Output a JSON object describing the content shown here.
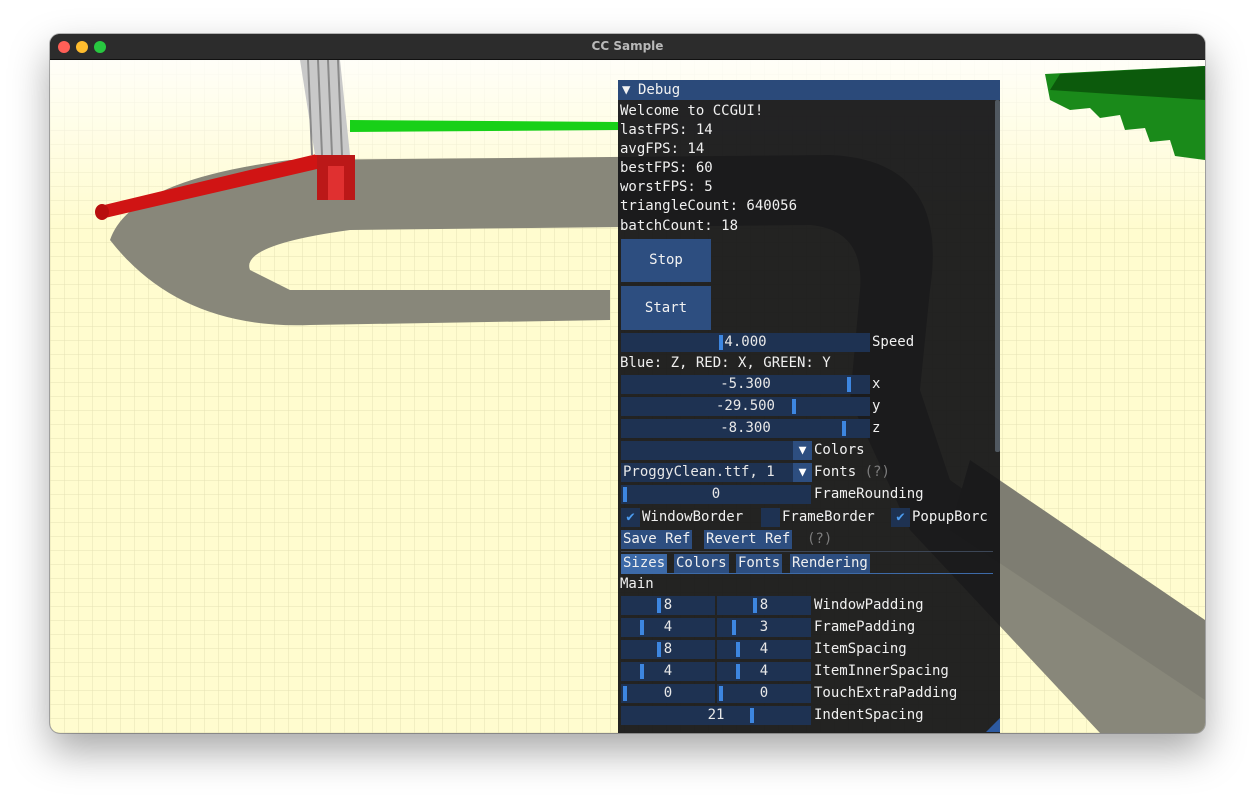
{
  "window": {
    "title": "CC Sample"
  },
  "debug": {
    "title": "Debug",
    "welcome": "Welcome to CCGUI!",
    "stats": [
      "lastFPS: 14",
      "avgFPS: 14",
      "bestFPS: 60",
      "worstFPS: 5",
      "triangleCount: 640056",
      "batchCount: 18"
    ],
    "stop_label": "Stop",
    "start_label": "Start",
    "speed": {
      "value": "4.000",
      "label": "Speed",
      "fraction": 0.4
    },
    "axis_hint": "Blue: Z, RED: X, GREEN: Y",
    "coords": [
      {
        "value": "-5.300",
        "label": "x",
        "fraction": 0.93
      },
      {
        "value": "-29.500",
        "label": "y",
        "fraction": 0.7
      },
      {
        "value": "-8.300",
        "label": "z",
        "fraction": 0.91
      }
    ],
    "colors_combo": {
      "value": "",
      "label": "Colors"
    },
    "fonts_combo": {
      "value": "ProggyClean.ttf, 1",
      "label": "Fonts",
      "help": "(?)"
    },
    "frame_rounding": {
      "value": "0",
      "label": "FrameRounding",
      "fraction": 0.0
    },
    "checkboxes": [
      {
        "label": "WindowBorder",
        "checked": true
      },
      {
        "label": "FrameBorder",
        "checked": false
      },
      {
        "label": "PopupBorc",
        "checked": true
      }
    ],
    "save_ref": "Save Ref",
    "revert_ref": "Revert Ref",
    "ref_help": "(?)",
    "tabs": [
      "Sizes",
      "Colors",
      "Fonts",
      "Rendering"
    ],
    "section": "Main",
    "sizes": [
      {
        "a": "8",
        "b": "8",
        "label": "WindowPadding",
        "fa": 0.4,
        "fb": 0.4
      },
      {
        "a": "4",
        "b": "3",
        "label": "FramePadding",
        "fa": 0.2,
        "fb": 0.15
      },
      {
        "a": "8",
        "b": "4",
        "label": "ItemSpacing",
        "fa": 0.4,
        "fb": 0.2
      },
      {
        "a": "4",
        "b": "4",
        "label": "ItemInnerSpacing",
        "fa": 0.2,
        "fb": 0.2
      },
      {
        "a": "0",
        "b": "0",
        "label": "TouchExtraPadding",
        "fa": 0.0,
        "fb": 0.0
      }
    ],
    "indent": {
      "value": "21",
      "label": "IndentSpacing",
      "fraction": 0.7
    },
    "colors": {
      "accent": "#3d86e0",
      "frame": "#1e3252",
      "button": "#2d4e80",
      "header": "#2b4a7a",
      "ground": "#fffccf"
    }
  }
}
